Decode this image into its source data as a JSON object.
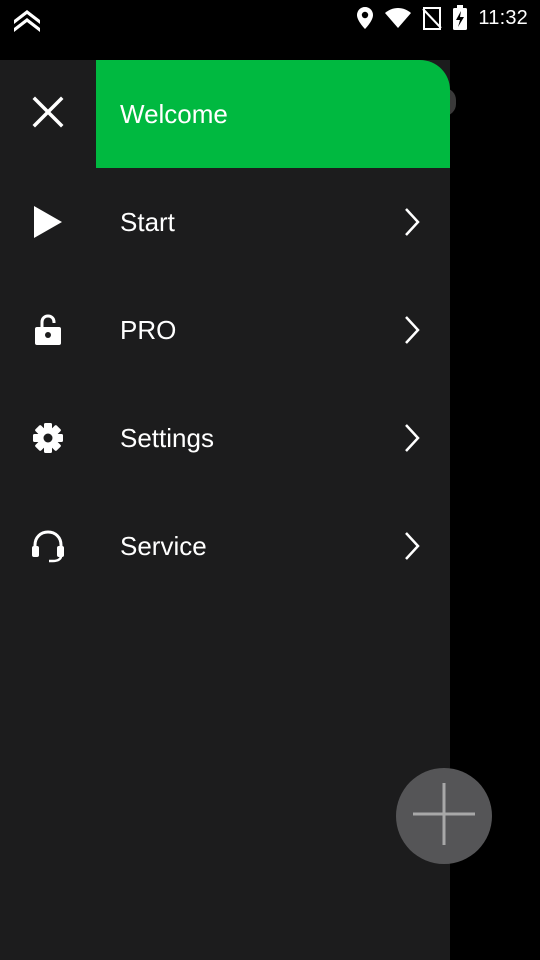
{
  "status_bar": {
    "time": "11:32",
    "icons": [
      "app-chevrons-icon",
      "location-icon",
      "wifi-icon",
      "no-sim-icon",
      "battery-charging-icon"
    ]
  },
  "drawer": {
    "header": {
      "close_icon": "close-icon",
      "title": "Welcome"
    },
    "items": [
      {
        "label": "Start",
        "icon": "play-icon"
      },
      {
        "label": "PRO",
        "icon": "unlock-icon"
      },
      {
        "label": "Settings",
        "icon": "gear-icon"
      },
      {
        "label": "Service",
        "icon": "headset-icon"
      }
    ]
  },
  "fab": {
    "icon": "plus-icon"
  },
  "colors": {
    "accent": "#00b940",
    "drawer_bg": "#1c1c1d",
    "background": "#000000",
    "fab_bg": "#555557"
  }
}
